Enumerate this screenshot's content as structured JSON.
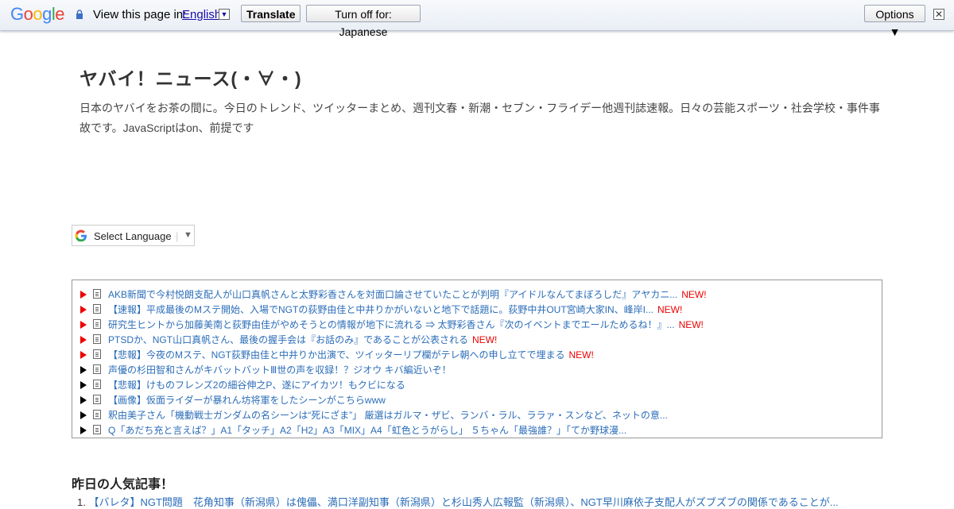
{
  "translate_bar": {
    "logo": [
      {
        "ch": "G",
        "color": "#4285f4"
      },
      {
        "ch": "o",
        "color": "#ea4335"
      },
      {
        "ch": "o",
        "color": "#fbbc05"
      },
      {
        "ch": "g",
        "color": "#4285f4"
      },
      {
        "ch": "l",
        "color": "#34a853"
      },
      {
        "ch": "e",
        "color": "#ea4335"
      }
    ],
    "view_in_label": "View this page in:",
    "language": "English",
    "translate_button": "Translate",
    "turn_off_button": "Turn off for: Japanese",
    "options_button": "Options ▼",
    "close_glyph": "✕"
  },
  "site": {
    "title": "ヤバイ！ニュース(・∀・)",
    "description": "日本のヤバイをお茶の間に。今日のトレンド、ツイッターまとめ、週刊文春・新潮・セブン・フライデー他週刊誌速報。日々の芸能スポーツ・社会学校・事件事故です。JavaScriptはon、前提です"
  },
  "language_select": {
    "label": "Select Language",
    "separator": "|",
    "arrow": "▼"
  },
  "news": [
    {
      "title": "AKB新聞で今村悦朗支配人が山口真帆さんと太野彩香さんを対面口論させていたことが判明『アイドルなんてまぼろしだ』アヤカニ...",
      "new": "NEW!",
      "hot": true
    },
    {
      "title": "【速報】平成最後のMステ開始、入場でNGTの荻野由佳と中井りかがいないと地下で話題に。荻野中井OUT宮崎大家IN、峰岸I...",
      "new": "NEW!",
      "hot": true
    },
    {
      "title": "研究生ヒントから加藤美南と荻野由佳がやめそうとの情報が地下に流れる ⇒ 太野彩香さん『次のイベントまでエールためるね！』...",
      "new": "NEW!",
      "hot": true
    },
    {
      "title": "PTSDか、NGT山口真帆さん、最後の握手会は『お話のみ』であることが公表される",
      "new": "NEW!",
      "hot": true
    },
    {
      "title": "【悲報】今夜のMステ、NGT荻野由佳と中井りか出演で、ツイッターリプ欄がテレ朝への申し立てで埋まる",
      "new": "NEW!",
      "hot": true
    },
    {
      "title": "声優の杉田智和さんがキバットバットⅢ世の声を収録！？ジオウ キバ編近いぞ！",
      "new": "",
      "hot": false
    },
    {
      "title": "【悲報】けものフレンズ2の細谷伸之P、遂にアイカツ！もクビになる",
      "new": "",
      "hot": false
    },
    {
      "title": "【画像】仮面ライダーが暴れん坊将軍をしたシーンがこちらwww",
      "new": "",
      "hot": false
    },
    {
      "title": "釈由美子さん「機動戦士ガンダムの名シーンは“死にざま”」 厳選はガルマ・ザビ、ランバ・ラル、ララァ・スンなど、ネットの意...",
      "new": "",
      "hot": false
    },
    {
      "title": "Q「あだち充と言えば？」A1「タッチ」A2「H2」A3「MIX」A4「虹色とうがらし」 ５ちゃん「最強誰？」「てか野球漫...",
      "new": "",
      "hot": false
    }
  ],
  "popular": {
    "heading": "昨日の人気記事！",
    "first_number": "1.",
    "first_title": "【バレタ】NGT問題　花角知事（新潟県）は傀儡、満口洋副知事（新潟県）と杉山秀人広報監（新潟県）、NGT早川麻依子支配人がズブズブの関係であることが..."
  }
}
